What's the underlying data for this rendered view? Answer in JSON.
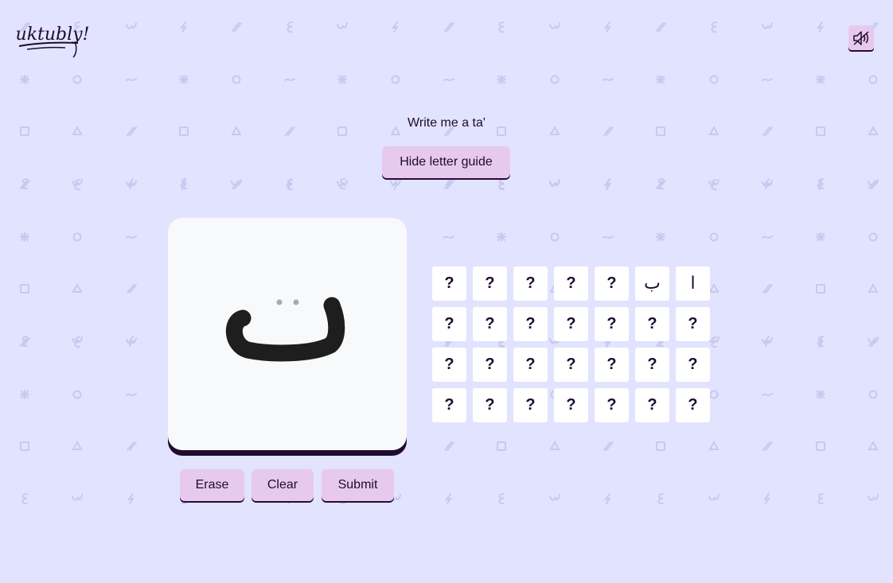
{
  "app": {
    "logo_text": "uktubly!"
  },
  "header": {
    "sound_icon": "speaker-muted-icon"
  },
  "prompt": {
    "text": "Write me a ta'"
  },
  "guide_button": {
    "label": "Hide letter guide"
  },
  "canvas": {
    "guide_letter": "ت",
    "stroke_color": "#1e0b2e"
  },
  "controls": {
    "erase_label": "Erase",
    "clear_label": "Clear",
    "submit_label": "Submit"
  },
  "letters": [
    "ا",
    "ب",
    "?",
    "?",
    "?",
    "?",
    "?",
    "?",
    "?",
    "?",
    "?",
    "?",
    "?",
    "?",
    "?",
    "?",
    "?",
    "?",
    "?",
    "?",
    "?",
    "?",
    "?",
    "?",
    "?",
    "?",
    "?",
    "?"
  ],
  "colors": {
    "background": "#e2e3fe",
    "pattern": "#c9c8f0",
    "button": "#e7c9ee",
    "ink": "#1e0b2e"
  },
  "background_pattern_icons": [
    "asterisk-icon",
    "circle-icon",
    "tilde-icon",
    "square-icon",
    "triangle-icon",
    "slash-icon",
    "ain-icon",
    "squiggle-icon",
    "lightning-icon"
  ]
}
